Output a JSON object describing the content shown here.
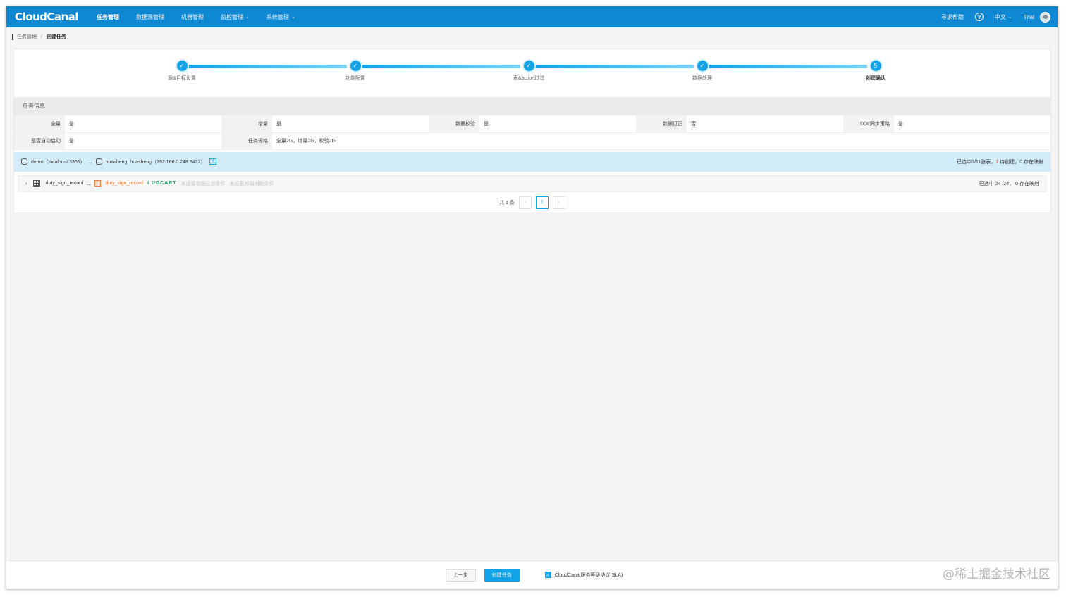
{
  "topbar": {
    "logo": "CloudCanal",
    "nav": [
      {
        "label": "任务管理",
        "active": true
      },
      {
        "label": "数据源管理"
      },
      {
        "label": "机器管理"
      },
      {
        "label": "监控管理",
        "dropdown": true
      },
      {
        "label": "系统管理",
        "dropdown": true
      }
    ],
    "help": "寻求帮助",
    "help_icon": "?",
    "lang": "中文",
    "user": "Trial"
  },
  "breadcrumb": {
    "parent": "任务管理",
    "separator": "/",
    "current": "创建任务"
  },
  "steps": [
    {
      "label": "源&目标设置",
      "done": true
    },
    {
      "label": "功能配置",
      "done": true
    },
    {
      "label": "表&action过滤",
      "done": true
    },
    {
      "label": "数据处理",
      "done": true
    },
    {
      "label": "创建确认",
      "number": "5",
      "current": true
    }
  ],
  "task_info": {
    "title": "任务信息",
    "row1": [
      {
        "key": "全量",
        "value": "是"
      },
      {
        "key": "增量",
        "value": "是"
      },
      {
        "key": "数据校验",
        "value": "是"
      },
      {
        "key": "数据订正",
        "value": "否"
      },
      {
        "key": "DDL同步策略",
        "value": "是"
      }
    ],
    "row2": [
      {
        "key": "是否自动启动",
        "value": "是"
      },
      {
        "key": "任务规格",
        "value": "全量2G，增量2G，校验2G"
      }
    ]
  },
  "db_mapping": {
    "source": "demo（localhost:3306）",
    "target": "huasheng .huasheng（192.168.0.248:5432）",
    "k_icon": "K",
    "summary_prefix": "已选中1/11张表，",
    "summary_pending": "1",
    "summary_suffix": " 待创建，0 存在映射"
  },
  "table_row": {
    "source_table": "duty_sign_record",
    "target_table": "duty_sign_record",
    "actions": "I UDCART",
    "filter_note": "未设置数据过滤条件",
    "sync_note": "未设置对端刷新条件",
    "summary": "已选中 24 /24，  0 存在映射"
  },
  "pager": {
    "total": "共 1 条",
    "page": "1",
    "prev": "‹",
    "next": "›"
  },
  "footer": {
    "prev_button": "上一步",
    "create_button": "创建任务",
    "sla_label": "CloudCanal服务等级协议(SLA)",
    "sla_checked": true
  },
  "watermark": "@稀土掘金技术社区",
  "colors": {
    "primary": "#0f88d4",
    "accent": "#12a3e6",
    "orange": "#f07d3a",
    "green": "#1aa260"
  }
}
